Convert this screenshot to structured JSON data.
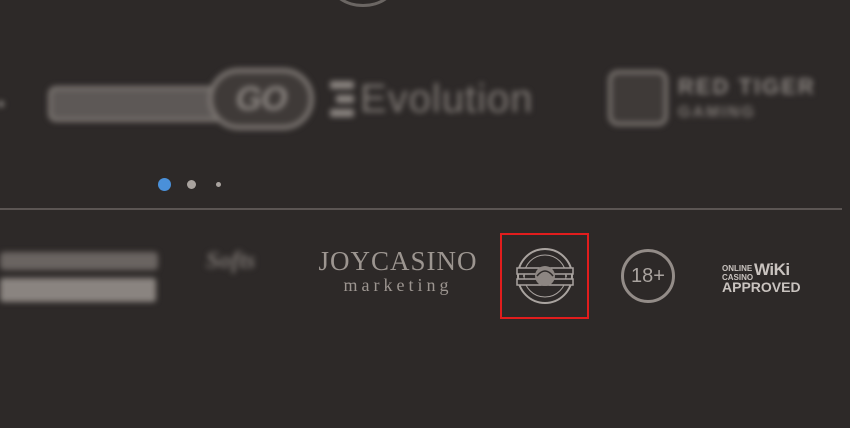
{
  "providers": {
    "items": [
      {
        "name": "Play'n GO",
        "logo_text": "GO",
        "blurred": true
      },
      {
        "name": "Evolution",
        "logo_text": "Evolution",
        "blurred": true
      },
      {
        "name": "Red Tiger",
        "logo_text_line1": "RED TIGER",
        "logo_text_line2": "GAMING",
        "blurred": true
      }
    ]
  },
  "carousel": {
    "dots": 3,
    "active_index": 0,
    "active_color": "#4a90d9",
    "inactive_color": "#a9a39f"
  },
  "footer": {
    "blurred_logo_2_text": "Softs",
    "joycasino": {
      "line1": "JOYCASINO",
      "line2": "marketing"
    },
    "seal": {
      "icon": "certification-seal-icon",
      "highlight_color": "#e11d1d"
    },
    "age_badge": {
      "text": "18+"
    },
    "wiki": {
      "small_line1": "ONLINE",
      "small_line2": "CASINO",
      "big": "WiKi",
      "approved": "APPROVED"
    }
  },
  "colors": {
    "background": "#2d2928",
    "divider": "#5b5553",
    "logo_gray": "#9c9590"
  }
}
